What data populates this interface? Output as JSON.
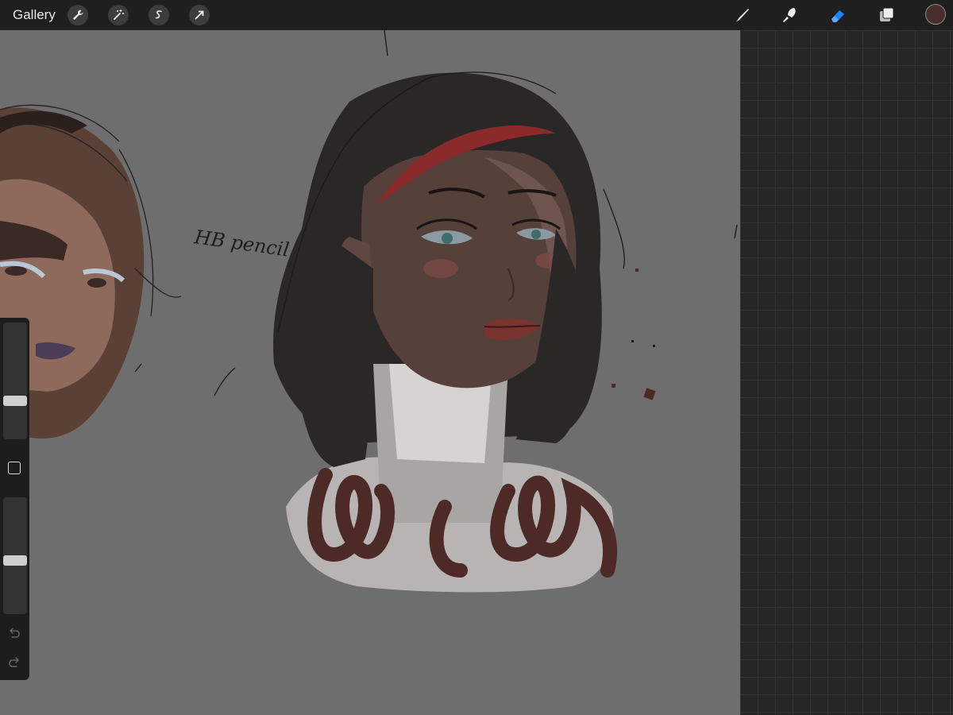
{
  "toolbar": {
    "gallery_label": "Gallery",
    "left_icons": [
      "wrench-icon",
      "magic-wand-icon",
      "selection-icon",
      "transform-arrow-icon"
    ],
    "right_icons": [
      "brush-icon",
      "smudge-icon",
      "eraser-icon",
      "layers-icon"
    ],
    "active_tool": "eraser",
    "active_tool_color": "#1a84ff",
    "current_color": "#4a2e2b"
  },
  "canvas": {
    "background_color": "#6e6e6e",
    "handwritten_note": "HB pencil"
  },
  "sidebar": {
    "brush_size_level": 0.62,
    "opacity_level": 0.35,
    "icons": [
      "modifier-square-icon",
      "undo-icon",
      "redo-icon"
    ]
  }
}
